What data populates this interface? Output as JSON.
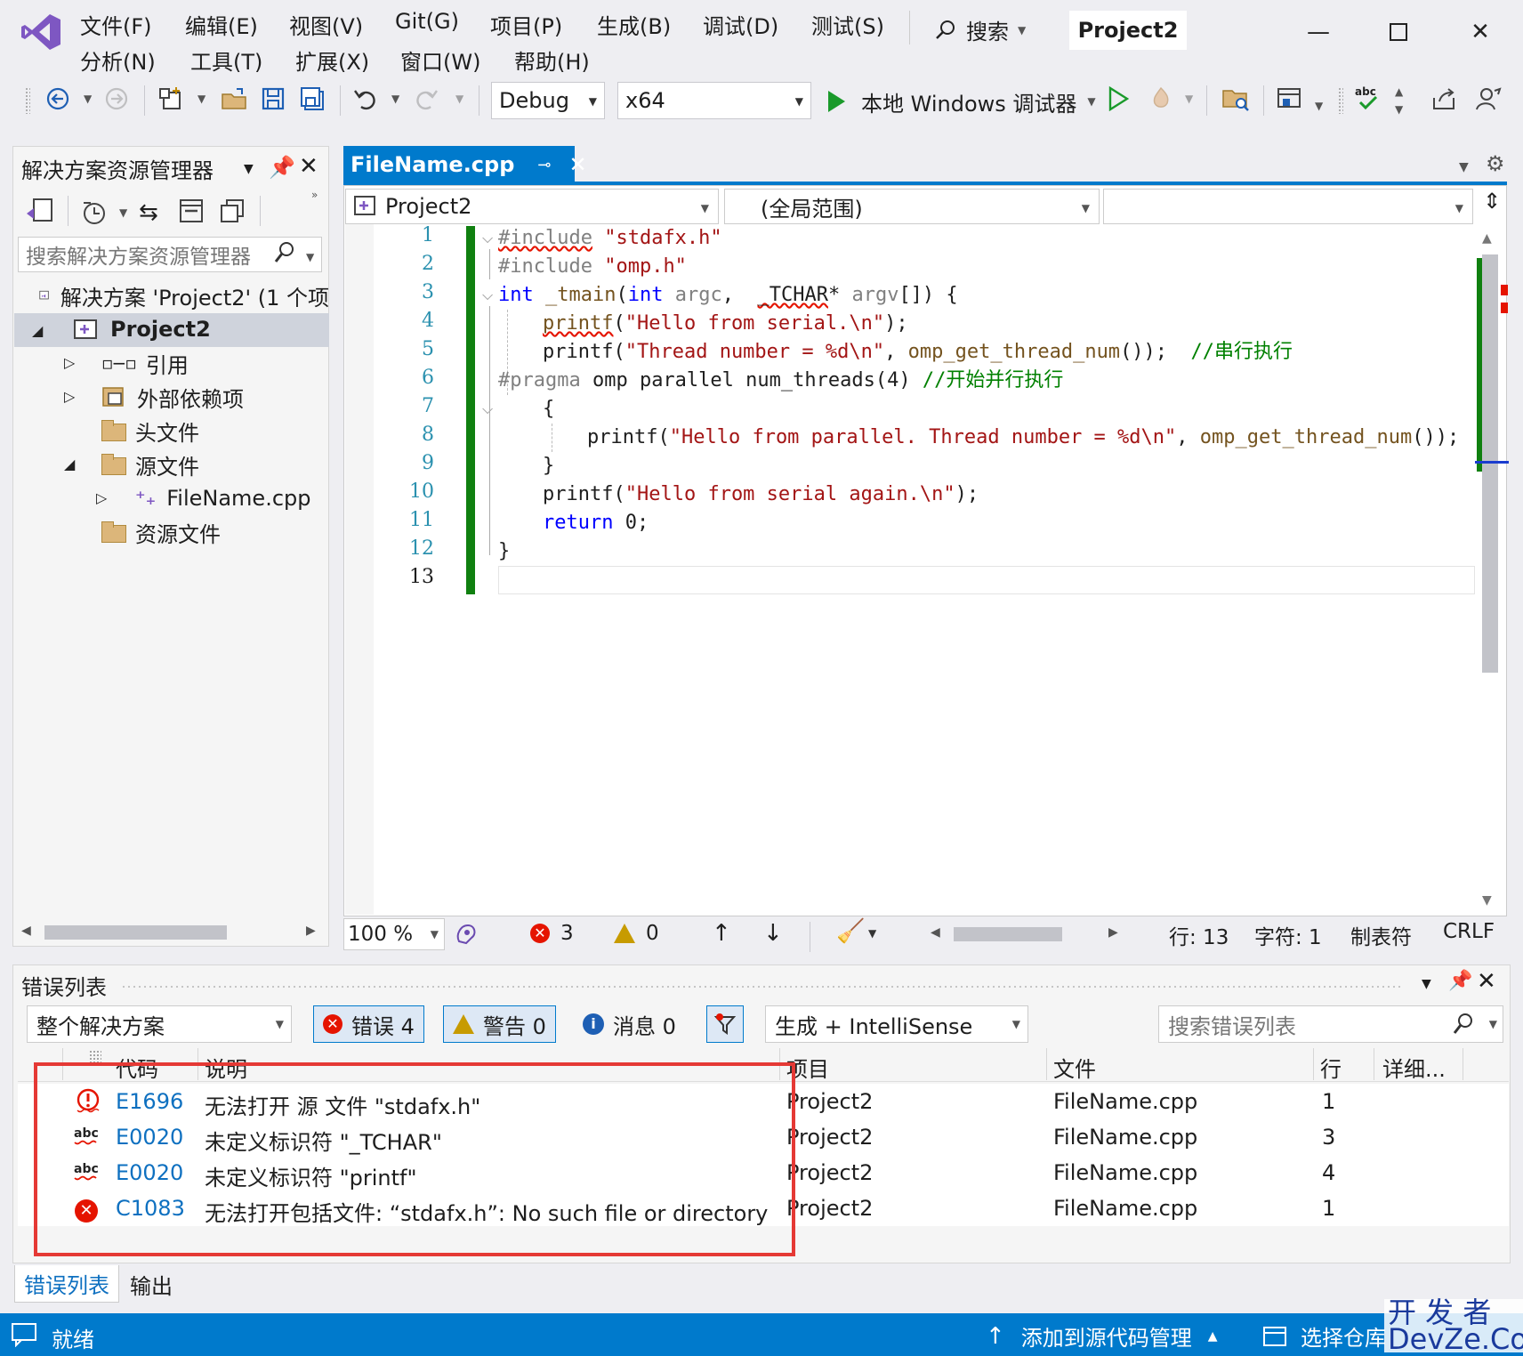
{
  "menu": {
    "row1": [
      "文件(F)",
      "编辑(E)",
      "视图(V)",
      "Git(G)",
      "项目(P)",
      "生成(B)",
      "调试(D)",
      "测试(S)"
    ],
    "row2": [
      "分析(N)",
      "工具(T)",
      "扩展(X)",
      "窗口(W)",
      "帮助(H)"
    ],
    "search_label": "搜索",
    "project_name": "Project2"
  },
  "toolbar": {
    "config": "Debug",
    "platform": "x64",
    "debugger_label": "本地 Windows 调试器"
  },
  "solution_explorer": {
    "title": "解决方案资源管理器",
    "search_placeholder": "搜索解决方案资源管理器",
    "items": [
      {
        "label": "解决方案 'Project2' (1 个项"
      },
      {
        "label": "Project2"
      },
      {
        "label": "引用"
      },
      {
        "label": "外部依赖项"
      },
      {
        "label": "头文件"
      },
      {
        "label": "源文件"
      },
      {
        "label": "FileName.cpp"
      },
      {
        "label": "资源文件"
      }
    ]
  },
  "editor": {
    "tab_title": "FileName.cpp",
    "nav_project": "Project2",
    "nav_scope": "(全局范围)",
    "line_numbers": [
      "1",
      "2",
      "3",
      "4",
      "5",
      "6",
      "7",
      "8",
      "9",
      "10",
      "11",
      "12",
      "13"
    ],
    "code": {
      "l1_a": "#include",
      "l1_b": " \"stdafx.h\"",
      "l2_a": "#include",
      "l2_b": " \"omp.h\"",
      "l3_kw": "int",
      "l3_fn": "_tmain",
      "l3_p1": "(",
      "l3_kw2": "int",
      "l3_argc": " argc",
      "l3_comma": ",  ",
      "l3_tchar": "_TCHAR",
      "l3_star": "* ",
      "l3_argv": "argv",
      "l3_end": "[]) {",
      "l4_fn": "printf",
      "l4_p": "(",
      "l4_str": "\"Hello from serial.\\n\"",
      "l4_end": ");",
      "l5_fn": "printf",
      "l5_p": "(",
      "l5_str": "\"Thread number = %d\\n\"",
      "l5_mid": ", ",
      "l5_call": "omp_get_thread_num",
      "l5_end": "());  ",
      "l5_cmt": "//串行执行",
      "l6_pp": "#pragma",
      "l6_rest": " omp parallel num_threads(4) ",
      "l6_cmt": "//开始并行执行",
      "l7": "{",
      "l8_fn": "printf",
      "l8_p": "(",
      "l8_str": "\"Hello from parallel. Thread number = %d\\n\"",
      "l8_mid": ", ",
      "l8_call": "omp_get_thread_num",
      "l8_end": "());",
      "l9": "}",
      "l10_fn": "printf",
      "l10_p": "(",
      "l10_str": "\"Hello from serial again.\\n\"",
      "l10_end": ");",
      "l11_kw": "return",
      "l11_rest": " 0;",
      "l12": "}"
    },
    "status": {
      "zoom": "100 %",
      "errors": "3",
      "warnings": "0",
      "line": "行: 13",
      "col": "字符: 1",
      "indent": "制表符",
      "eol": "CRLF"
    }
  },
  "error_list": {
    "title": "错误列表",
    "scope": "整个解决方案",
    "errors_btn": "错误 4",
    "warnings_btn": "警告 0",
    "messages_btn": "消息 0",
    "source": "生成 + IntelliSense",
    "search_placeholder": "搜索错误列表",
    "columns": [
      "代码",
      "说明",
      "项目",
      "文件",
      "行",
      "详细..."
    ],
    "rows": [
      {
        "code": "E1696",
        "desc": "无法打开 源 文件 \"stdafx.h\"",
        "project": "Project2",
        "file": "FileName.cpp",
        "line": "1"
      },
      {
        "code": "E0020",
        "desc": "未定义标识符 \"_TCHAR\"",
        "project": "Project2",
        "file": "FileName.cpp",
        "line": "3"
      },
      {
        "code": "E0020",
        "desc": "未定义标识符 \"printf\"",
        "project": "Project2",
        "file": "FileName.cpp",
        "line": "4"
      },
      {
        "code": "C1083",
        "desc": "无法打开包括文件: “stdafx.h”: No such file or directory",
        "project": "Project2",
        "file": "FileName.cpp",
        "line": "1"
      }
    ],
    "tabs": [
      "错误列表",
      "输出"
    ]
  },
  "statusbar": {
    "ready": "就绪",
    "add_source": "添加到源代码管理",
    "select_repo": "选择仓库"
  },
  "watermark": {
    "line1": "开 发 者",
    "line2": "DevZe.CoM"
  },
  "colors": {
    "accent": "#007acc",
    "error": "#e51400",
    "change_bar": "#108010",
    "highlight_frame": "#e53935"
  }
}
